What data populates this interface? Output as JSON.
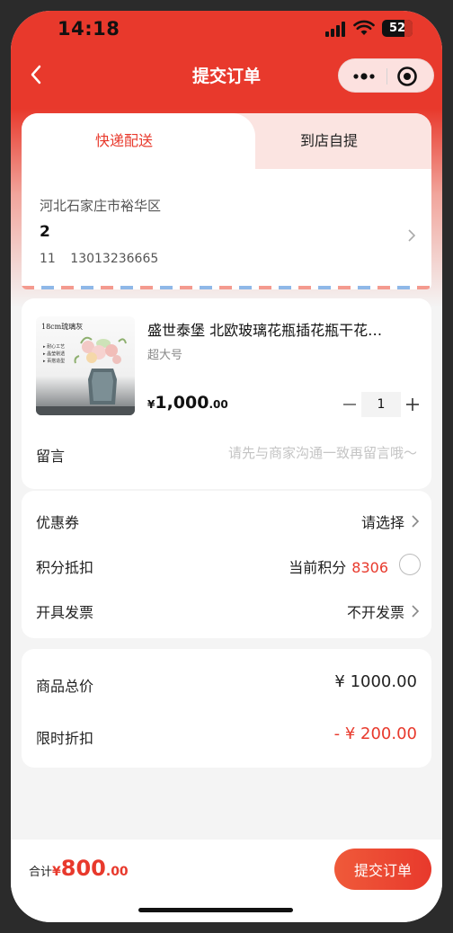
{
  "status_bar": {
    "time": "14:18",
    "battery": "52"
  },
  "nav": {
    "title": "提交订单"
  },
  "delivery_tabs": {
    "express": "快递配送",
    "pickup": "到店自提"
  },
  "address": {
    "region": "河北石家庄市裕华区",
    "detail": "2",
    "name": "11",
    "phone": "13013236665"
  },
  "product": {
    "title": "盛世泰堡 北欧玻璃花瓶插花瓶干花…",
    "spec": "超大号",
    "price_currency": "¥",
    "price_int": "1,000",
    "price_dec": ".00",
    "quantity": "1",
    "thumb_title": "18cm琉璃灰",
    "thumb_bullets": [
      "▸ 耐心工艺",
      "▸ 晶莹剔透",
      "▸ 百搭造型"
    ]
  },
  "note": {
    "label": "留言",
    "placeholder": "请先与商家沟通一致再留言哦～"
  },
  "options": {
    "coupon": {
      "label": "优惠券",
      "value": "请选择"
    },
    "points": {
      "label": "积分抵扣",
      "prefix": "当前积分",
      "value": "8306"
    },
    "invoice": {
      "label": "开具发票",
      "value": "不开发票"
    }
  },
  "summary": {
    "goods_total": {
      "label": "商品总价",
      "value": "¥ 1000.00"
    },
    "discount": {
      "label": "限时折扣",
      "value": "- ¥ 200.00"
    }
  },
  "footer": {
    "total_label": "合计",
    "total_currency": "¥",
    "total_int": "800",
    "total_dec": ".00",
    "submit_label": "提交订单"
  },
  "colors": {
    "brand_red": "#e8392c",
    "background": "#f4f4f4"
  }
}
